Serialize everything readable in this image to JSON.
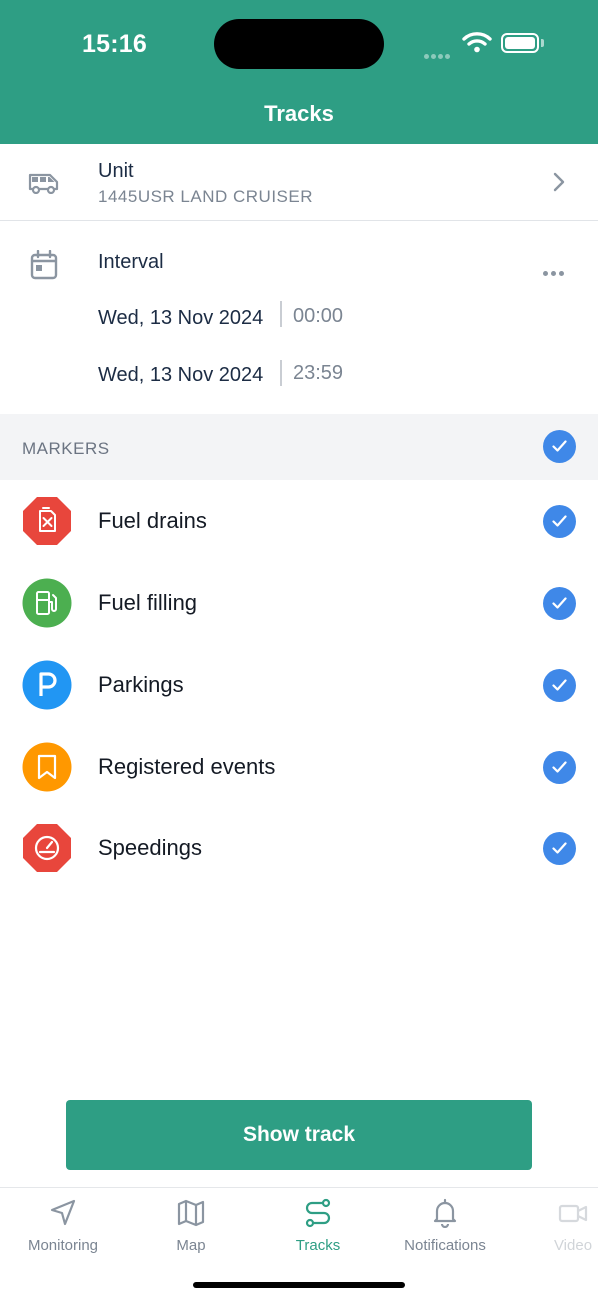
{
  "status_bar": {
    "time": "15:16"
  },
  "header": {
    "title": "Tracks"
  },
  "unit": {
    "label": "Unit",
    "value": "1445USR LAND CRUISER",
    "icon": "van-icon"
  },
  "interval": {
    "label": "Interval",
    "from": {
      "date": "Wed, 13 Nov 2024",
      "time": "00:00"
    },
    "to": {
      "date": "Wed, 13 Nov 2024",
      "time": "23:59"
    }
  },
  "markers": {
    "header": "MARKERS",
    "all_checked": true,
    "items": [
      {
        "label": "Fuel drains",
        "icon": "fuel-drain-icon",
        "color": "#e8463c",
        "checked": true
      },
      {
        "label": "Fuel filling",
        "icon": "fuel-pump-icon",
        "color": "#4caf50",
        "checked": true
      },
      {
        "label": "Parkings",
        "icon": "parking-icon",
        "color": "#2196f3",
        "checked": true
      },
      {
        "label": "Registered events",
        "icon": "bookmark-icon",
        "color": "#ff9800",
        "checked": true
      },
      {
        "label": "Speedings",
        "icon": "speedometer-icon",
        "color": "#e8463c",
        "checked": true
      }
    ]
  },
  "actions": {
    "show_track": "Show track"
  },
  "tabbar": {
    "items": [
      {
        "label": "Monitoring",
        "icon": "navigation-arrow-icon"
      },
      {
        "label": "Map",
        "icon": "map-icon"
      },
      {
        "label": "Tracks",
        "icon": "route-icon",
        "active": true
      },
      {
        "label": "Notifications",
        "icon": "bell-icon"
      },
      {
        "label": "Video",
        "icon": "video-icon"
      }
    ]
  },
  "colors": {
    "accent": "#2e9e84",
    "check": "#3f88e8"
  }
}
